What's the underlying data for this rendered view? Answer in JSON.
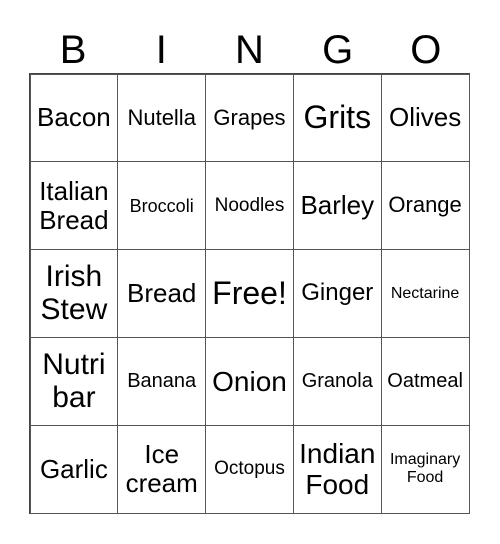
{
  "header": [
    "B",
    "I",
    "N",
    "G",
    "O"
  ],
  "cells": [
    {
      "text": "Bacon",
      "size": 26
    },
    {
      "text": "Nutella",
      "size": 22
    },
    {
      "text": "Grapes",
      "size": 22
    },
    {
      "text": "Grits",
      "size": 32
    },
    {
      "text": "Olives",
      "size": 26
    },
    {
      "text": "Italian\nBread",
      "size": 26
    },
    {
      "text": "Broccoli",
      "size": 18
    },
    {
      "text": "Noodles",
      "size": 19
    },
    {
      "text": "Barley",
      "size": 26
    },
    {
      "text": "Orange",
      "size": 22
    },
    {
      "text": "Irish\nStew",
      "size": 30
    },
    {
      "text": "Bread",
      "size": 26
    },
    {
      "text": "Free!",
      "size": 32
    },
    {
      "text": "Ginger",
      "size": 24
    },
    {
      "text": "Nectarine",
      "size": 16
    },
    {
      "text": "Nutri\nbar",
      "size": 30
    },
    {
      "text": "Banana",
      "size": 20
    },
    {
      "text": "Onion",
      "size": 28
    },
    {
      "text": "Granola",
      "size": 20
    },
    {
      "text": "Oatmeal",
      "size": 20
    },
    {
      "text": "Garlic",
      "size": 26
    },
    {
      "text": "Ice\ncream",
      "size": 26
    },
    {
      "text": "Octopus",
      "size": 19
    },
    {
      "text": "Indian\nFood",
      "size": 28
    },
    {
      "text": "Imaginary\nFood",
      "size": 16
    }
  ]
}
